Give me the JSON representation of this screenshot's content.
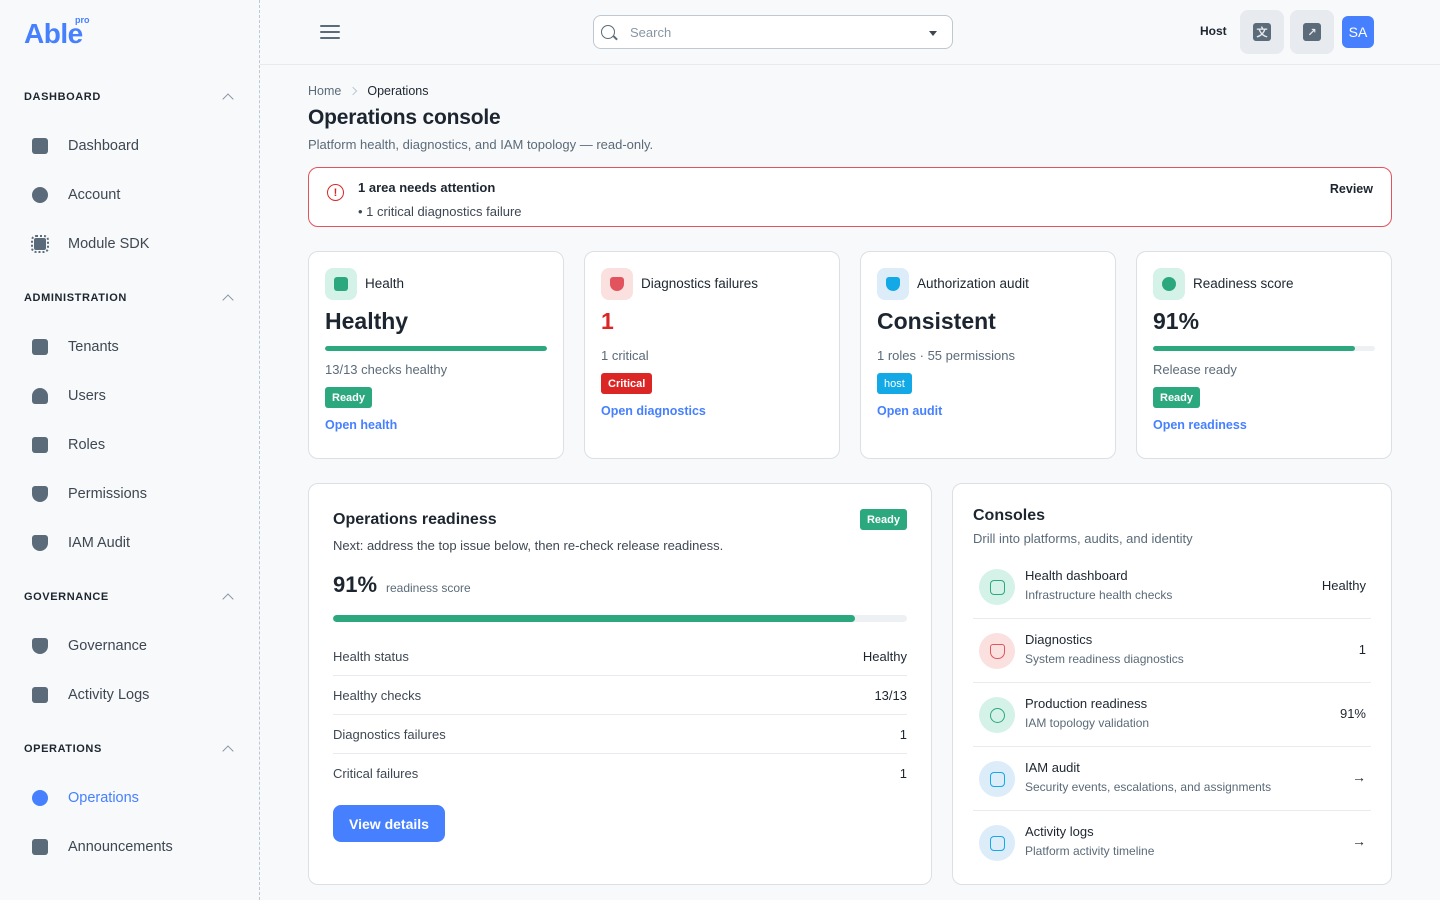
{
  "brand": {
    "name": "Able",
    "tag": "pro"
  },
  "sidebar": {
    "sections": [
      {
        "title": "DASHBOARD",
        "items": [
          {
            "label": "Dashboard",
            "icon": "document-icon"
          },
          {
            "label": "Account",
            "icon": "user-circle-icon"
          },
          {
            "label": "Module SDK",
            "icon": "chip-icon"
          }
        ]
      },
      {
        "title": "ADMINISTRATION",
        "items": [
          {
            "label": "Tenants",
            "icon": "building-icon"
          },
          {
            "label": "Users",
            "icon": "user-icon"
          },
          {
            "label": "Roles",
            "icon": "id-badge-icon"
          },
          {
            "label": "Permissions",
            "icon": "shield-icon"
          },
          {
            "label": "IAM Audit",
            "icon": "shield-icon"
          }
        ]
      },
      {
        "title": "GOVERNANCE",
        "items": [
          {
            "label": "Governance",
            "icon": "shield-icon"
          },
          {
            "label": "Activity Logs",
            "icon": "document-icon"
          }
        ]
      },
      {
        "title": "OPERATIONS",
        "items": [
          {
            "label": "Operations",
            "icon": "cog-icon",
            "active": true
          },
          {
            "label": "Announcements",
            "icon": "document-icon"
          }
        ]
      }
    ]
  },
  "header": {
    "search_placeholder": "Search",
    "tenant": "Host",
    "avatar_initials": "SA"
  },
  "breadcrumb": {
    "home": "Home",
    "current": "Operations"
  },
  "page": {
    "title": "Operations console",
    "subtitle": "Platform health, diagnostics, and IAM topology — read-only."
  },
  "alert": {
    "title": "1 area needs attention",
    "item": "• 1 critical diagnostics failure",
    "action": "Review"
  },
  "stats": [
    {
      "title": "Health",
      "value": "Healthy",
      "progress": 1.0,
      "note": "13/13 checks healthy",
      "badge": "Ready",
      "link": "Open health"
    },
    {
      "title": "Diagnostics failures",
      "value": "1",
      "note": "1 critical",
      "badge": "Critical",
      "link": "Open diagnostics"
    },
    {
      "title": "Authorization audit",
      "value": "Consistent",
      "note": "1 roles · 55 permissions",
      "badge": "host",
      "link": "Open audit"
    },
    {
      "title": "Readiness score",
      "value": "91%",
      "progress": 0.91,
      "note": "Release ready",
      "badge": "Ready",
      "link": "Open readiness"
    }
  ],
  "readiness": {
    "title": "Operations readiness",
    "badge": "Ready",
    "subtitle": "Next: address the top issue below, then re-check release readiness.",
    "score": "91%",
    "score_label": "readiness score",
    "progress": 0.91,
    "rows": [
      {
        "label": "Health status",
        "value": "Healthy"
      },
      {
        "label": "Healthy checks",
        "value": "13/13"
      },
      {
        "label": "Diagnostics failures",
        "value": "1"
      },
      {
        "label": "Critical failures",
        "value": "1"
      }
    ],
    "button": "View details"
  },
  "consoles": {
    "title": "Consoles",
    "subtitle": "Drill into platforms, audits, and identity",
    "items": [
      {
        "name": "Health dashboard",
        "desc": "Infrastructure health checks",
        "value": "Healthy",
        "icon": "heartbeat-icon"
      },
      {
        "name": "Diagnostics",
        "desc": "System readiness diagnostics",
        "value": "1",
        "icon": "shield-alert-icon"
      },
      {
        "name": "Production readiness",
        "desc": "IAM topology validation",
        "value": "91%",
        "icon": "gear-icon"
      },
      {
        "name": "IAM audit",
        "desc": "Security events, escalations, and assignments",
        "value": "→",
        "icon": "clipboard-icon"
      },
      {
        "name": "Activity logs",
        "desc": "Platform activity timeline",
        "value": "→",
        "icon": "trend-icon"
      }
    ]
  },
  "colors": {
    "primary": "#4680ff",
    "success": "#2ca87f",
    "danger": "#dc2626",
    "info": "#13a8e6"
  }
}
